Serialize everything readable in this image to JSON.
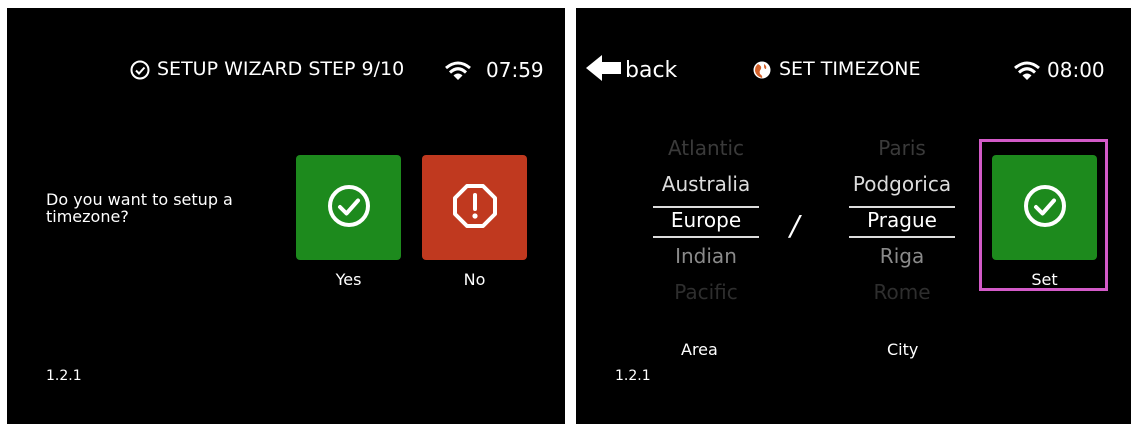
{
  "colors": {
    "green": "#1d8a1d",
    "red": "#c0391f",
    "highlight": "#d35ac8",
    "dim1": "#3a3a3a",
    "dim2": "#8a8a8a",
    "selected": "#ffffff"
  },
  "left": {
    "header_icon": "check-circle-icon",
    "header_title": "SETUP WIZARD STEP 9/10",
    "wifi_icon": "wifi-icon",
    "time": "07:59",
    "question": "Do you want to setup a timezone?",
    "yes_label": "Yes",
    "yes_icon": "check-circle-icon",
    "no_label": "No",
    "no_icon": "warning-octagon-icon",
    "version": "1.2.1"
  },
  "right": {
    "back_icon": "arrow-left-icon",
    "back_label": "back",
    "header_icon": "globe-icon",
    "header_title": "SET TIMEZONE",
    "wifi_icon": "wifi-icon",
    "time": "08:00",
    "area_roller": [
      "Atlantic",
      "Australia",
      "Europe",
      "Indian",
      "Pacific"
    ],
    "area_selected_index": 2,
    "separator": "/",
    "city_roller": [
      "Paris",
      "Podgorica",
      "Prague",
      "Riga",
      "Rome"
    ],
    "city_selected_index": 2,
    "area_label": "Area",
    "city_label": "City",
    "set_label": "Set",
    "set_icon": "check-circle-icon",
    "version": "1.2.1"
  }
}
